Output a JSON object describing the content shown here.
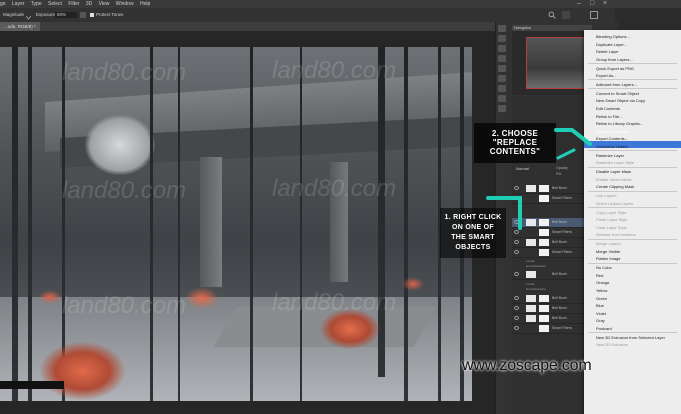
{
  "menubar": {
    "items": [
      "ge",
      "Layer",
      "Type",
      "Select",
      "Filter",
      "3D",
      "View",
      "Window",
      "Help"
    ]
  },
  "options": {
    "mode_label": "Magnitude",
    "exposure_label": "Exposure:",
    "exposure_value": "50%",
    "protect_label": "Protect Tones"
  },
  "document": {
    "tab_label": "...ode, RGB/8) *"
  },
  "panels": {
    "navigator_label": "Navigator",
    "layers_mode": "Normal",
    "opacity_label": "Opacity:",
    "fill_label": "Fill:",
    "layer_names": [
      "Bell Bush",
      "Smart Filters",
      "Bell Bush",
      "Smart Filters",
      "Bell Bush",
      "Smart Filters",
      "Bell Bush",
      "Bell Bush",
      "Bell Bush",
      "Bell Bush",
      "Smart Filters"
    ],
    "sub_labels": [
      "Levels",
      "Hue/Saturation",
      "Levels",
      "Hue/Saturation"
    ]
  },
  "context_menu": {
    "items": [
      {
        "label": "Blending Options...",
        "disabled": false
      },
      {
        "label": "Duplicate Layer...",
        "disabled": false
      },
      {
        "label": "Delete Layer",
        "disabled": false
      },
      {
        "label": "Group from Layers...",
        "disabled": false
      },
      {
        "label": "Quick Export as PNG",
        "disabled": false
      },
      {
        "label": "Export As...",
        "disabled": false
      },
      {
        "label": "Artboard from Layers...",
        "disabled": false
      },
      {
        "label": "Convert to Smart Object",
        "disabled": false
      },
      {
        "label": "New Smart Object via Copy",
        "disabled": false
      },
      {
        "label": "Edit Contents",
        "disabled": false
      },
      {
        "label": "Relink to File...",
        "disabled": false
      },
      {
        "label": "Relink to Library Graphic...",
        "disabled": false
      },
      {
        "label": "Replace Contents...",
        "disabled": false,
        "highlighted": true
      },
      {
        "label": "Export Contents...",
        "disabled": false
      },
      {
        "label": "Convert to Linked...",
        "disabled": false
      },
      {
        "label": "Rasterize Layer",
        "disabled": false
      },
      {
        "label": "Rasterize Layer Style",
        "disabled": true
      },
      {
        "label": "Disable Layer Mask",
        "disabled": false
      },
      {
        "label": "Enable Vector Mask",
        "disabled": true
      },
      {
        "label": "Create Clipping Mask",
        "disabled": false
      },
      {
        "label": "Link Layers",
        "disabled": true
      },
      {
        "label": "Select Linked Layers",
        "disabled": true
      },
      {
        "label": "Copy Layer Style",
        "disabled": true
      },
      {
        "label": "Paste Layer Style",
        "disabled": true
      },
      {
        "label": "Clear Layer Style",
        "disabled": true
      },
      {
        "label": "Release from Isolation",
        "disabled": true
      },
      {
        "label": "Merge Layers",
        "disabled": true
      },
      {
        "label": "Merge Visible",
        "disabled": false
      },
      {
        "label": "Flatten Image",
        "disabled": false
      },
      {
        "label": "No Color",
        "disabled": false
      },
      {
        "label": "Red",
        "disabled": false
      },
      {
        "label": "Orange",
        "disabled": false
      },
      {
        "label": "Yellow",
        "disabled": false
      },
      {
        "label": "Green",
        "disabled": false
      },
      {
        "label": "Blue",
        "disabled": false
      },
      {
        "label": "Violet",
        "disabled": false
      },
      {
        "label": "Gray",
        "disabled": false
      },
      {
        "label": "Postcard",
        "disabled": false
      },
      {
        "label": "New 3D Extrusion from Selected Layer",
        "disabled": false
      },
      {
        "label": "New 3D Extrusion",
        "disabled": true
      }
    ]
  },
  "annotations": {
    "step2_line1": "2. CHOOSE",
    "step2_line2": "\"REPLACE",
    "step2_line3": "CONTENTS\"",
    "step1_line1": "1. RIGHT CLICK",
    "step1_line2": "ON ONE OF",
    "step1_line3": "THE SMART",
    "step1_line4": "OBJECTS",
    "accent_color": "#1ecfb6"
  },
  "watermark": {
    "text": "land80.com"
  },
  "brand": {
    "url": "www.zoscape.com"
  }
}
